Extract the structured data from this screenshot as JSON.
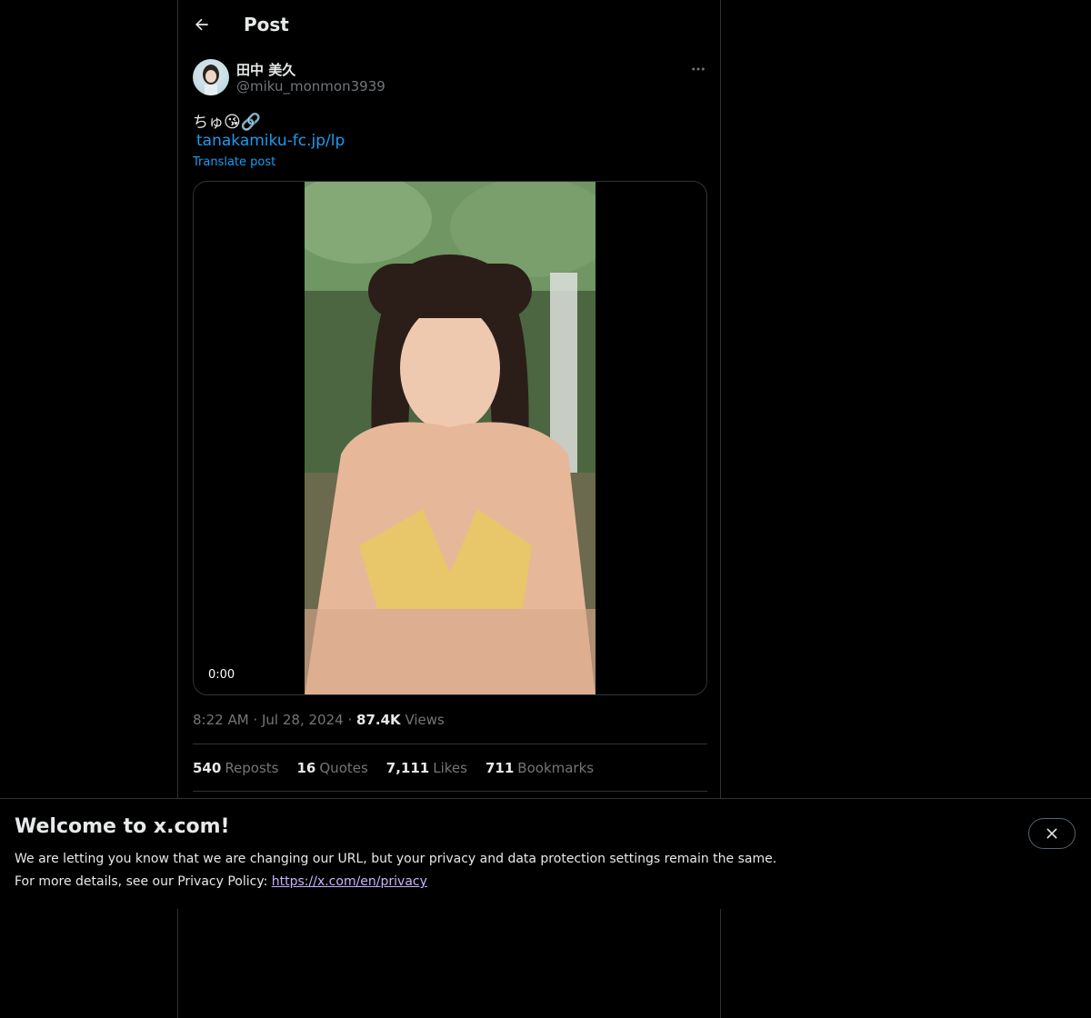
{
  "header": {
    "title": "Post"
  },
  "post": {
    "display_name": "田中 美久",
    "handle": "@miku_monmon3939",
    "text": "ちゅ",
    "emojis": "😘🔗",
    "link": "tanakamiku-fc.jp/lp",
    "translate_label": "Translate post",
    "video_time": "0:00",
    "time": "8:22 AM",
    "date": "Jul 28, 2024",
    "views_count": "87.4K",
    "views_label": "Views",
    "sep": "·"
  },
  "stats": [
    {
      "count": "540",
      "label": "Reposts"
    },
    {
      "count": "16",
      "label": "Quotes"
    },
    {
      "count": "7,111",
      "label": "Likes"
    },
    {
      "count": "711",
      "label": "Bookmarks"
    }
  ],
  "banner": {
    "title": "Welcome to x.com!",
    "line1": "We are letting you know that we are changing our URL, but your privacy and data protection settings remain the same.",
    "line2_prefix": "For more details, see our Privacy Policy: ",
    "line2_link": "https://x.com/en/privacy"
  },
  "icons": {
    "back": "arrow-left-icon",
    "more": "more-horizontal-icon",
    "close": "close-icon"
  },
  "colors": {
    "link": "#1d9bf0",
    "muted": "#71767b",
    "border": "#2f3336",
    "text": "#e7e9ea",
    "banner_link": "#c8b3ff"
  }
}
